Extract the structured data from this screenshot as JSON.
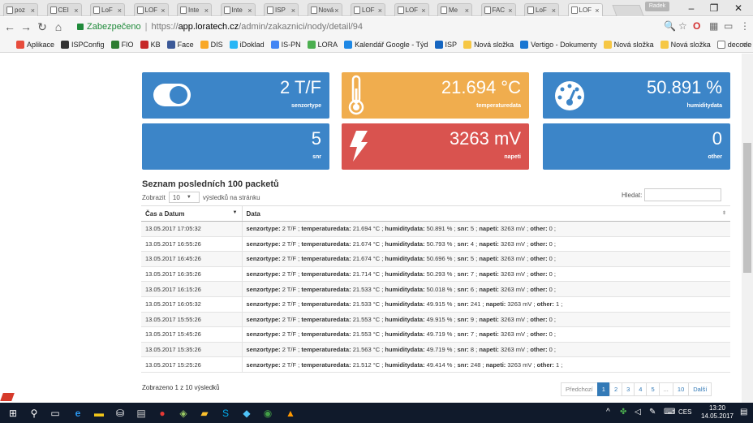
{
  "browser": {
    "tabs": [
      {
        "label": "poz",
        "active": false
      },
      {
        "label": "CEI",
        "active": false
      },
      {
        "label": "LoF",
        "active": false
      },
      {
        "label": "LOF",
        "active": false
      },
      {
        "label": "Inte",
        "active": false
      },
      {
        "label": "Inte",
        "active": false
      },
      {
        "label": "ISP",
        "active": false
      },
      {
        "label": "Nová",
        "active": false
      },
      {
        "label": "LOF",
        "active": false
      },
      {
        "label": "LOF",
        "active": false
      },
      {
        "label": "Me",
        "active": false
      },
      {
        "label": "FAC",
        "active": false
      },
      {
        "label": "LoF",
        "active": false
      },
      {
        "label": "LOF",
        "active": true
      }
    ],
    "user_badge": "Radek",
    "secure_label": "Zabezpečeno",
    "url_scheme": "https://",
    "url_host": "app.loratech.cz",
    "url_path": "/admin/zakaznici/nody/detail/94",
    "bookmarks": [
      {
        "label": "Aplikace",
        "color": "#e74c3c"
      },
      {
        "label": "ISPConfig",
        "color": "#333333"
      },
      {
        "label": "FIO",
        "color": "#2e7d32"
      },
      {
        "label": "KB",
        "color": "#c62828"
      },
      {
        "label": "Face",
        "color": "#3b5998"
      },
      {
        "label": "DIS",
        "color": "#f9a825"
      },
      {
        "label": "iDoklad",
        "color": "#29b6f6"
      },
      {
        "label": "IS-PN",
        "color": "#4285f4"
      },
      {
        "label": "LORA",
        "color": "#4caf50"
      },
      {
        "label": "Kalendář Google - Týd",
        "color": "#1e88e5"
      },
      {
        "label": "ISP",
        "color": "#1565c0"
      },
      {
        "label": "Nová složka",
        "color": "#f6c744"
      },
      {
        "label": "Vertigo - Dokumenty",
        "color": "#1976d2"
      },
      {
        "label": "Nová složka",
        "color": "#f6c744"
      },
      {
        "label": "Nová složka",
        "color": "#f6c744"
      },
      {
        "label": "decode",
        "color": "#ffffff"
      }
    ],
    "bookmarks_more": "»"
  },
  "stats": [
    {
      "value": "2 T/F",
      "label": "senzortype",
      "color": "#3c85c8",
      "icon": "toggle-icon"
    },
    {
      "value": "21.694 °C",
      "label": "temperaturedata",
      "color": "#f0ad4e",
      "icon": "thermometer-icon"
    },
    {
      "value": "50.891 %",
      "label": "humiditydata",
      "color": "#3c85c8",
      "icon": "dashboard-icon"
    },
    {
      "value": "5",
      "label": "snr",
      "color": "#3c85c8",
      "icon": ""
    },
    {
      "value": "3263 mV",
      "label": "napeti",
      "color": "#d9534f",
      "icon": "bolt-icon"
    },
    {
      "value": "0",
      "label": "other",
      "color": "#3c85c8",
      "icon": ""
    }
  ],
  "table_section": {
    "title": "Seznam posledních 100 packetů",
    "length_prefix": "Zobrazit",
    "length_value": "10",
    "length_suffix": "výsledků na stránku",
    "search_label": "Hledat:",
    "columns": [
      "Čas a Datum",
      "Data"
    ],
    "rows": [
      {
        "time": "13.05.2017 17:05:32",
        "senzortype": "2 T/F",
        "temperaturedata": "21.694 °C",
        "humiditydata": "50.891 %",
        "snr": "5",
        "napeti": "3263 mV",
        "other": "0"
      },
      {
        "time": "13.05.2017 16:55:26",
        "senzortype": "2 T/F",
        "temperaturedata": "21.674 °C",
        "humiditydata": "50.793 %",
        "snr": "4",
        "napeti": "3263 mV",
        "other": "0"
      },
      {
        "time": "13.05.2017 16:45:26",
        "senzortype": "2 T/F",
        "temperaturedata": "21.674 °C",
        "humiditydata": "50.696 %",
        "snr": "5",
        "napeti": "3263 mV",
        "other": "0"
      },
      {
        "time": "13.05.2017 16:35:26",
        "senzortype": "2 T/F",
        "temperaturedata": "21.714 °C",
        "humiditydata": "50.293 %",
        "snr": "7",
        "napeti": "3263 mV",
        "other": "0"
      },
      {
        "time": "13.05.2017 16:15:26",
        "senzortype": "2 T/F",
        "temperaturedata": "21.533 °C",
        "humiditydata": "50.018 %",
        "snr": "6",
        "napeti": "3263 mV",
        "other": "0"
      },
      {
        "time": "13.05.2017 16:05:32",
        "senzortype": "2 T/F",
        "temperaturedata": "21.533 °C",
        "humiditydata": "49.915 %",
        "snr": "241",
        "napeti": "3263 mV",
        "other": "1"
      },
      {
        "time": "13.05.2017 15:55:26",
        "senzortype": "2 T/F",
        "temperaturedata": "21.553 °C",
        "humiditydata": "49.915 %",
        "snr": "9",
        "napeti": "3263 mV",
        "other": "0"
      },
      {
        "time": "13.05.2017 15:45:26",
        "senzortype": "2 T/F",
        "temperaturedata": "21.553 °C",
        "humiditydata": "49.719 %",
        "snr": "7",
        "napeti": "3263 mV",
        "other": "0"
      },
      {
        "time": "13.05.2017 15:35:26",
        "senzortype": "2 T/F",
        "temperaturedata": "21.563 °C",
        "humiditydata": "49.719 %",
        "snr": "8",
        "napeti": "3263 mV",
        "other": "0"
      },
      {
        "time": "13.05.2017 15:25:26",
        "senzortype": "2 T/F",
        "temperaturedata": "21.512 °C",
        "humiditydata": "49.414 %",
        "snr": "248",
        "napeti": "3263 mV",
        "other": "1"
      }
    ],
    "info": "Zobrazeno 1 z 10 výsledků",
    "pagination": {
      "prev": "Předchozí",
      "pages": [
        "1",
        "2",
        "3",
        "4",
        "5",
        "...",
        "10"
      ],
      "active_page": "1",
      "next": "Další"
    }
  },
  "taskbar": {
    "language": "CES",
    "time": "13:20",
    "date": "14.05.2017"
  }
}
